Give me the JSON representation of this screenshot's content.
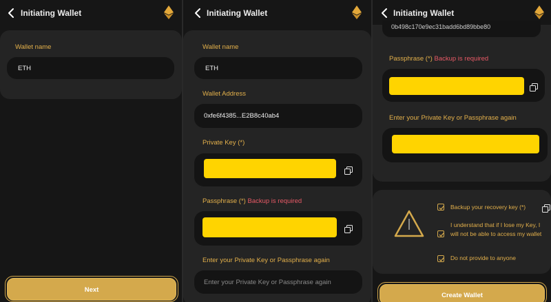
{
  "colors": {
    "accent": "#e3b04b",
    "warning": "#e85a66",
    "mask": "#ffd400",
    "button": "#d4a94c"
  },
  "header": {
    "title": "Initiating Wallet"
  },
  "step1": {
    "wallet_name_label": "Wallet name",
    "wallet_name_value": "ETH",
    "next_label": "Next"
  },
  "step2": {
    "wallet_name_label": "Wallet name",
    "wallet_name_value": "ETH",
    "wallet_address_label": "Wallet Address",
    "wallet_address_value": "0xfe6f4385...E2B8c40ab4",
    "private_key_label": "Private Key (*)",
    "passphrase_label": "Passphrase (*)",
    "backup_required": "Backup is required",
    "confirm_label": "Enter your Private Key or Passphrase again",
    "confirm_placeholder": "Enter your Private Key or Passphrase again"
  },
  "step3": {
    "partial_address": "0b498c170e9ec31badd6bd89bbe80",
    "passphrase_label": "Passphrase (*)",
    "backup_required": "Backup is required",
    "confirm_label": "Enter your Private Key or Passphrase again",
    "checks": [
      "Backup your recovery key (*)",
      "I understand that if I lose my Key, I will not be able to access my wallet",
      "Do not provide to anyone"
    ],
    "create_label": "Create Wallet"
  },
  "icons": {
    "back": "chevron-left-icon",
    "eth": "ethereum-icon",
    "copy": "copy-icon",
    "warning": "warning-triangle-icon",
    "check": "checkbox-checked-icon"
  }
}
